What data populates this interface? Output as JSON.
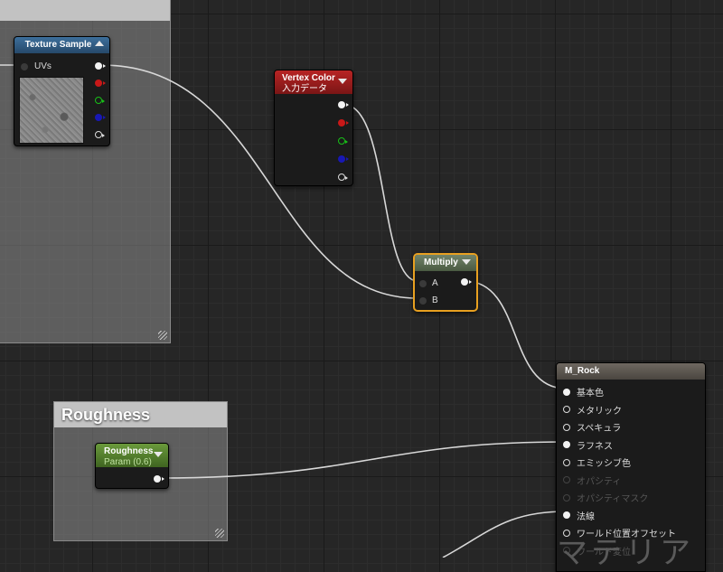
{
  "comment_boxes": {
    "top_left": {
      "title": ""
    },
    "roughness": {
      "title": "Roughness"
    }
  },
  "nodes": {
    "texture_sample": {
      "title": "Texture Sample",
      "header_color": "#2e5a80",
      "pins": {
        "uvs": "UVs"
      }
    },
    "vertex_color": {
      "title": "Vertex Color",
      "subtitle": "入力データ",
      "header_color": "#9a1d1d"
    },
    "multiply": {
      "title": "Multiply",
      "header_color": "#5a6a52",
      "pins": {
        "a": "A",
        "b": "B"
      }
    },
    "roughness_param": {
      "title": "Roughness",
      "subtitle": "Param (0.6)",
      "header_color": "#4f7a2a"
    },
    "material_output": {
      "title": "M_Rock",
      "header_color": "#5c5650",
      "inputs": [
        {
          "label": "基本色",
          "enabled": true,
          "connected": true
        },
        {
          "label": "メタリック",
          "enabled": true,
          "connected": false
        },
        {
          "label": "スペキュラ",
          "enabled": true,
          "connected": false
        },
        {
          "label": "ラフネス",
          "enabled": true,
          "connected": true
        },
        {
          "label": "エミッシブ色",
          "enabled": true,
          "connected": false
        },
        {
          "label": "オパシティ",
          "enabled": false,
          "connected": false
        },
        {
          "label": "オパシティマスク",
          "enabled": false,
          "connected": false
        },
        {
          "label": "法線",
          "enabled": true,
          "connected": true
        },
        {
          "label": "ワールド位置オフセット",
          "enabled": true,
          "connected": false
        },
        {
          "label": "ワールド変位",
          "enabled": false,
          "connected": false
        }
      ]
    }
  },
  "watermark": "マテリア",
  "colors": {
    "selection_outline": "#e8a020",
    "wire": "#d8d8d8",
    "grid_bg": "#262626"
  }
}
